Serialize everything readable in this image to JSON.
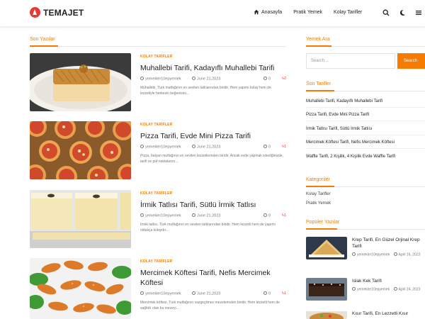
{
  "site": {
    "name": "TEMAJET",
    "accent": "#f57c00",
    "logo_color": "#e53935"
  },
  "nav": {
    "items": [
      {
        "label": "Anasayfa",
        "icon": "home-icon"
      },
      {
        "label": "Pratik Yemek"
      },
      {
        "label": "Kolay Tarifler"
      }
    ],
    "icons": [
      "search-icon",
      "dark-mode-moon-icon",
      "menu-icon"
    ]
  },
  "main": {
    "section_title": "Son Yazılar",
    "posts": [
      {
        "category": "KOLAY TARİFLER",
        "title": "Muhallebi Tarifi, Kadayıflı Muhallebi Tarifi",
        "author": "yemekler10epyemek",
        "date": "June 21,2023",
        "comments": "0",
        "likes": "2",
        "excerpt": "Muhallebi, Türk mutfağının en sevilen tatlılarından biridir. Hem yapımı kolay hem de lezzetiyle herkesin beğenisini..."
      },
      {
        "category": "KOLAY TARİFLER",
        "title": "Pizza Tarifi, Evde Mini Pizza Tarifi",
        "author": "yemekler10epyemek",
        "date": "June 21,2023",
        "comments": "0",
        "likes": "1",
        "excerpt": "Pizza, İtalyan mutfağının en sevilen lezzetlerinden biridir. Ancak evde yapmak istediğinizde, tarifi ve püf noktalarını..."
      },
      {
        "category": "KOLAY TARİFLER",
        "title": "İrmik Tatlısı Tarifi, Sütlü İrmik Tatlısı",
        "author": "yemekler10epyemek",
        "date": "June 21,2023",
        "comments": "0",
        "likes": "1",
        "excerpt": "İrmik tatlısı, Türk mutfağının en sevilen tatlılarından biridir. Hem lezzetli hem de yapımı oldukça kolaydır..."
      },
      {
        "category": "KOLAY TARİFLER",
        "title": "Mercimek Köftesi Tarifi, Nefis Mercimek Köftesi",
        "author": "yemekler10epyemek",
        "date": "June 21,2023",
        "comments": "0",
        "likes": "1",
        "excerpt": "Mercimek köftesi, Türk mutfağının vazgeçilmez mezelerinden biridir. Hem lezzetli hem de sağlıklı olan bu mezeyi..."
      }
    ]
  },
  "sidebar": {
    "search": {
      "title": "Yemek Ara",
      "placeholder": "Search ...",
      "button": "Search"
    },
    "recent": {
      "title": "Son Tarifler",
      "items": [
        "Muhallebi Tarifi, Kadayıflı Muhallebi Tarifi",
        "Pizza Tarifi, Evde Mini Pizza Tarifi",
        "İrmik Tatlısı Tarifi, Sütlü İrmik Tatlısı",
        "Mercimek Köftesi Tarifi, Nefis Mercimek Köftesi",
        "Waffle Tarifi, 2 Kişilik, 4 Kişilik Evde Waffle Tarifi"
      ]
    },
    "categories": {
      "title": "Kategoriler",
      "items": [
        "Kolay Tarifler",
        "Pratik Yemek"
      ]
    },
    "popular": {
      "title": "Popüler Yazılar",
      "items": [
        {
          "title": "Krep Tarifi, En Güzel Orjinal Krep Tarifi",
          "author": "yemekler10epyemek",
          "date": "April 16, 2023"
        },
        {
          "title": "Islak Kek Tarifi",
          "author": "yemekler10epyemek",
          "date": "April 24, 2023"
        },
        {
          "title": "Kısır Tarifi, En Lezzetli Kısır"
        }
      ]
    }
  }
}
